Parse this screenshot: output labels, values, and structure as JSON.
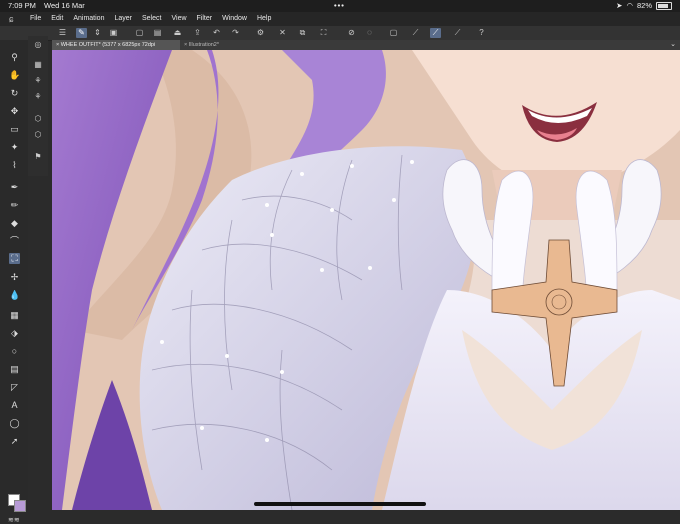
{
  "status": {
    "time": "7:09 PM",
    "date": "Wed 16 Mar",
    "dots": "•••",
    "battery": "82%",
    "battery_level": 0.82,
    "wifi_icon": "wifi-icon",
    "location_icon": "location-icon"
  },
  "menu": {
    "logo_icon": "clip-studio-logo-icon",
    "items": [
      "File",
      "Edit",
      "Animation",
      "Layer",
      "Select",
      "View",
      "Filter",
      "Window",
      "Help"
    ]
  },
  "tabs": [
    {
      "label": "× WHEE OUTFIT* (5377 x 6825px 72dpi 254.0%)",
      "active": true
    },
    {
      "label": "× Illustration2*",
      "active": false
    }
  ],
  "tab_collapse_icon": "chevron-down-icon",
  "colors": {
    "accent": "#5a6d8c",
    "main_color": "#ffffff",
    "sub_color": "#b79bd6"
  },
  "tools": [
    "zoom-icon",
    "hand-icon",
    "rotate-icon",
    "move-icon",
    "select-rect-icon",
    "magic-wand-icon",
    "eyedropper-icon",
    "pen-icon",
    "pencil-icon",
    "eraser-icon",
    "fill-icon",
    "gradient-icon",
    "sparkle-icon",
    "water-drop-icon",
    "figure-icon",
    "arrow-icon",
    "circle-icon",
    "frame-icon",
    "ruler-icon",
    "text-icon",
    "speech-bubble-icon",
    "correction-icon"
  ],
  "sub_tools": [
    "brush-icon",
    "layer-icon",
    "transform-icon",
    "layer-mask-icon",
    "cube-icon",
    "stack-icon",
    "flag-icon"
  ],
  "command_icons": [
    "menu-icon",
    "pen-active-icon",
    "arrows-icon",
    "canvas-icon",
    "new-icon",
    "open-icon",
    "save-icon",
    "export-icon",
    "cloud-icon",
    "undo-icon",
    "redo-icon",
    "gear-icon",
    "deselect-icon",
    "invert-selection-icon",
    "transform-icon",
    "crop-icon",
    "lasso-icon",
    "snap-icon",
    "snap-active-icon",
    "snap-ruler-icon",
    "help-icon"
  ]
}
